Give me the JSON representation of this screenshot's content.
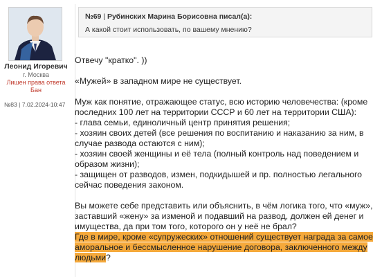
{
  "author": {
    "name": "Леонид Игоревич",
    "city": "г. Москва",
    "status": "Лишен права ответа",
    "ban": "Бан"
  },
  "post": {
    "meta": "№83 | 7.02.2024-10:47"
  },
  "quote": {
    "number": "№69",
    "separator": " | ",
    "header": "Рубинских Марина Борисовна писал(а):",
    "text": "А какой стоит использовать, по вашему мнению?"
  },
  "body": {
    "line1": "Отвечу \"кратко\". ))",
    "line2": "«Мужей» в западном мире не существует.",
    "para3": [
      "Муж как понятие, отражающее статус, всю историю человечества: (кроме",
      "последних 100 лет на территории СССР и 60 лет на территории США):",
      "- глава семьи, единоличный центр принятия решения;",
      "- хозяин своих детей (все решения по воспитанию и наказанию за ним, в",
      "случае развода остаются с ним);",
      "- хозяин своей женщины и её тела (полный контроль над поведением и",
      "образом жизни);",
      "- защищен от разводов, измен, подкидышей и пр. полностью легального",
      "сейчас поведения законом."
    ],
    "para4": [
      "Вы можете себе представить или объяснить, в чём логика того, что «муж»,",
      "заставший «жену» за изменой и подавший на развод, должен ей денег и",
      "имущества, да при том того, которого он у неё не брал?"
    ],
    "highlight": [
      "Где в мире, кроме «супружеских» отношений существует награда за самое",
      "аморальное и бессмысленное нарушение договора, заключенного между",
      "людьми"
    ],
    "highlight_end": "?"
  },
  "colors": {
    "highlight": "#f5a93b",
    "quote_bg": "#f4f4f4",
    "warning_red": "#c0392b"
  }
}
